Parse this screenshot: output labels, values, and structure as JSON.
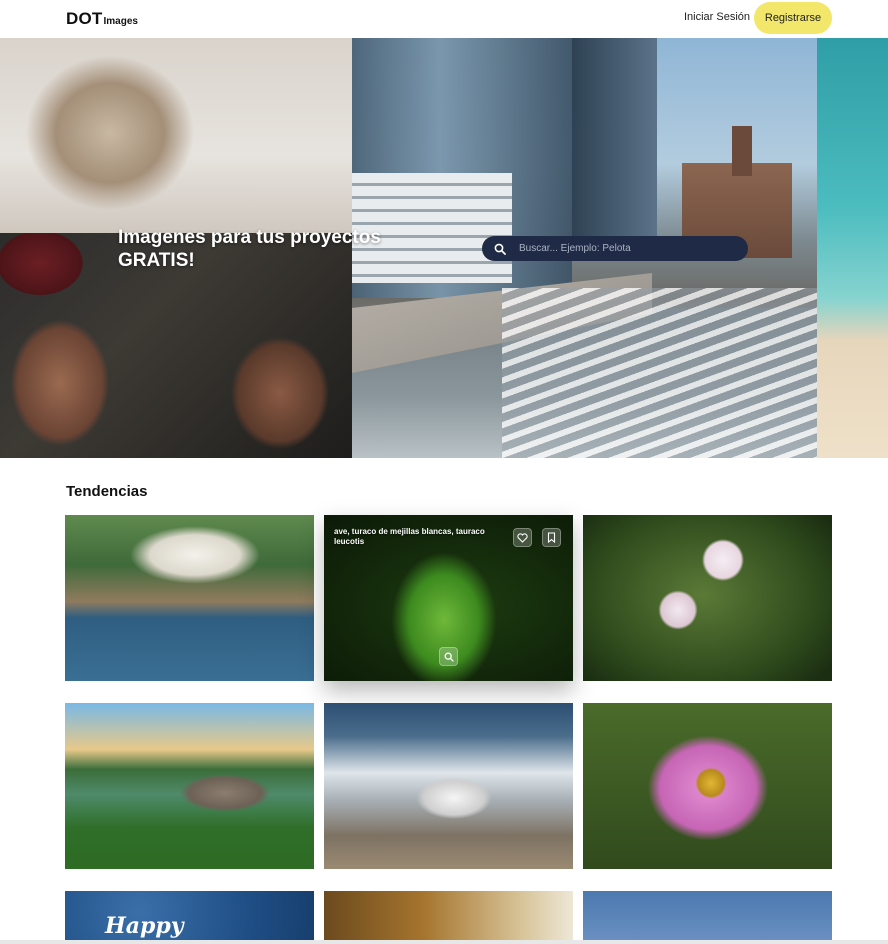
{
  "header": {
    "logo_main": "DOT",
    "logo_sub": "Images",
    "login_label": "Iniciar Sesión",
    "register_label": "Registrarse"
  },
  "hero": {
    "title": "Imagenes para tus proyectos GRATIS!",
    "search_placeholder": "Buscar... Ejemplo: Pelota"
  },
  "trending": {
    "title": "Tendencias",
    "cards": [
      {
        "image": "coastal-village-harbor"
      },
      {
        "image": "green-turaco-bird",
        "caption": "ave, turaco de mejillas blancas, tauraco leucotis",
        "icons": [
          "heart-icon",
          "bookmark-icon",
          "zoom-icon"
        ]
      },
      {
        "image": "white-cherry-blossom"
      },
      {
        "image": "rooster-on-log-lake"
      },
      {
        "image": "seagull-on-beach"
      },
      {
        "image": "pink-cosmos-with-bee"
      },
      {
        "image": "happy-blue-background",
        "overlay_text": "Happy"
      },
      {
        "image": "autumn-trees"
      },
      {
        "image": "birds-flying-sky"
      }
    ]
  },
  "colors": {
    "register_bg": "#f2e66b",
    "search_bg": "#1f2b46"
  }
}
